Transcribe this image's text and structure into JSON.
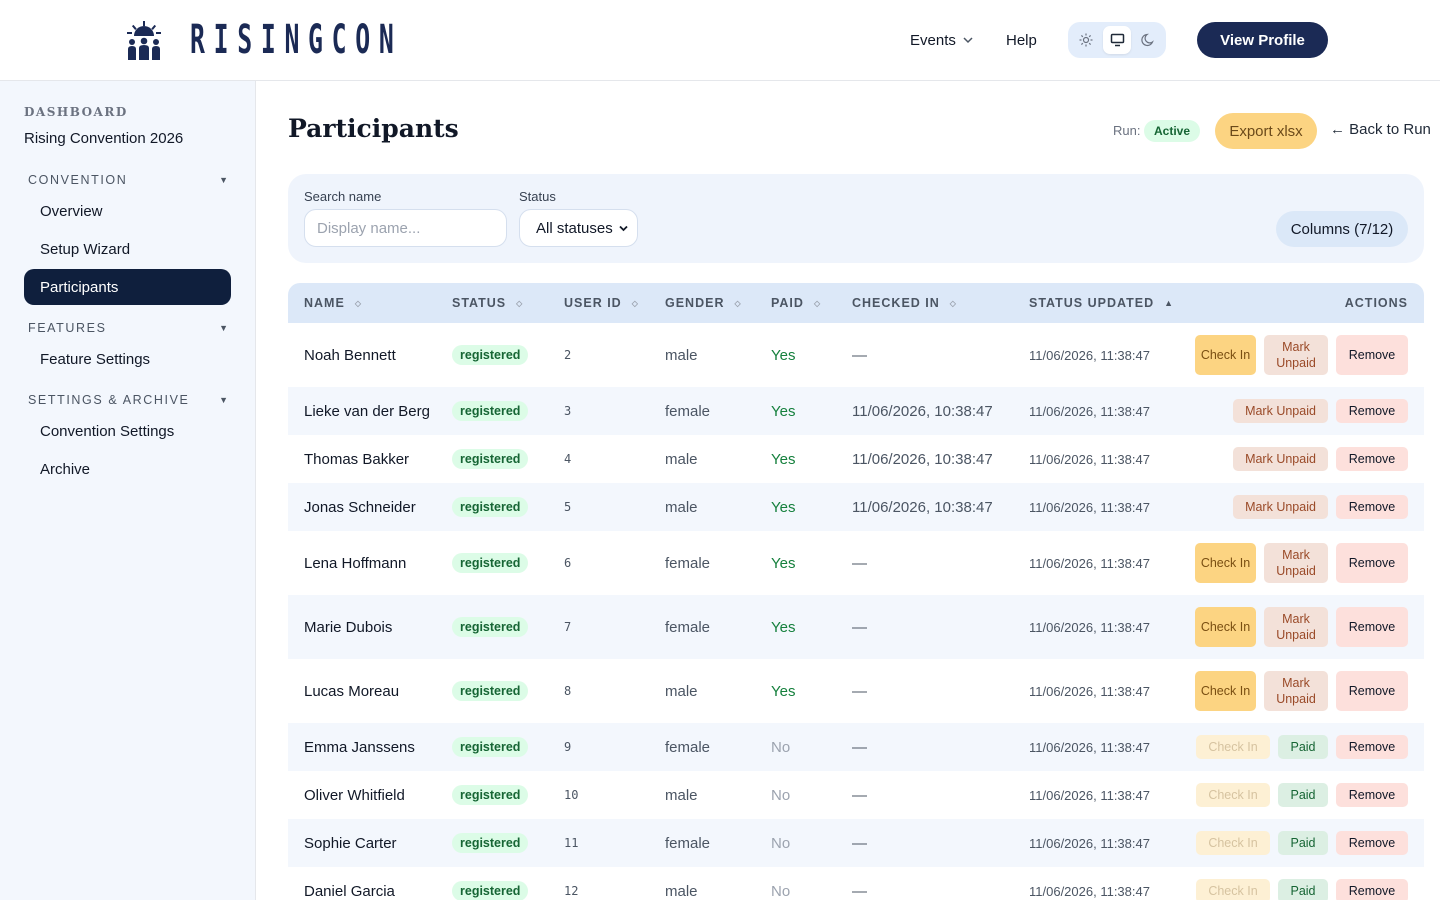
{
  "header": {
    "logo_text": "RISINGCON",
    "nav": {
      "events_label": "Events",
      "help_label": "Help"
    },
    "view_profile_label": "View Profile"
  },
  "sidebar": {
    "kicker": "DASHBOARD",
    "convention_name": "Rising Convention 2026",
    "sections": [
      {
        "title": "CONVENTION",
        "items": [
          {
            "label": "Overview"
          },
          {
            "label": "Setup Wizard"
          },
          {
            "label": "Participants",
            "active": true
          }
        ]
      },
      {
        "title": "FEATURES",
        "items": [
          {
            "label": "Feature Settings"
          }
        ]
      },
      {
        "title": "SETTINGS & ARCHIVE",
        "items": [
          {
            "label": "Convention Settings"
          },
          {
            "label": "Archive"
          }
        ]
      }
    ]
  },
  "main": {
    "title": "Participants",
    "run_label": "Run:",
    "run_status": "Active",
    "export_label": "Export xlsx",
    "back_label": "← Back to Run",
    "filters": {
      "search_label": "Search name",
      "search_placeholder": "Display name...",
      "search_value": "",
      "status_label": "Status",
      "status_selected": "All statuses",
      "columns_label": "Columns (7/12)"
    },
    "table": {
      "columns": [
        "NAME",
        "STATUS",
        "USER ID",
        "GENDER",
        "PAID",
        "CHECKED IN",
        "STATUS UPDATED",
        "ACTIONS"
      ],
      "sorted_column": "STATUS UPDATED",
      "rows": [
        {
          "name": "Noah Bennett",
          "status": "registered",
          "user_id": "2",
          "gender": "male",
          "paid": "Yes",
          "checked_in": "—",
          "updated": "11/06/2026, 11:38:47",
          "actions": [
            "Check In",
            "Mark Unpaid",
            "Remove"
          ]
        },
        {
          "name": "Lieke van der Berg",
          "status": "registered",
          "user_id": "3",
          "gender": "female",
          "paid": "Yes",
          "checked_in": "11/06/2026, 10:38:47",
          "updated": "11/06/2026, 11:38:47",
          "actions": [
            "Mark Unpaid",
            "Remove"
          ]
        },
        {
          "name": "Thomas Bakker",
          "status": "registered",
          "user_id": "4",
          "gender": "male",
          "paid": "Yes",
          "checked_in": "11/06/2026, 10:38:47",
          "updated": "11/06/2026, 11:38:47",
          "actions": [
            "Mark Unpaid",
            "Remove"
          ]
        },
        {
          "name": "Jonas Schneider",
          "status": "registered",
          "user_id": "5",
          "gender": "male",
          "paid": "Yes",
          "checked_in": "11/06/2026, 10:38:47",
          "updated": "11/06/2026, 11:38:47",
          "actions": [
            "Mark Unpaid",
            "Remove"
          ]
        },
        {
          "name": "Lena Hoffmann",
          "status": "registered",
          "user_id": "6",
          "gender": "female",
          "paid": "Yes",
          "checked_in": "—",
          "updated": "11/06/2026, 11:38:47",
          "actions": [
            "Check In",
            "Mark Unpaid",
            "Remove"
          ]
        },
        {
          "name": "Marie Dubois",
          "status": "registered",
          "user_id": "7",
          "gender": "female",
          "paid": "Yes",
          "checked_in": "—",
          "updated": "11/06/2026, 11:38:47",
          "actions": [
            "Check In",
            "Mark Unpaid",
            "Remove"
          ]
        },
        {
          "name": "Lucas Moreau",
          "status": "registered",
          "user_id": "8",
          "gender": "male",
          "paid": "Yes",
          "checked_in": "—",
          "updated": "11/06/2026, 11:38:47",
          "actions": [
            "Check In",
            "Mark Unpaid",
            "Remove"
          ]
        },
        {
          "name": "Emma Janssens",
          "status": "registered",
          "user_id": "9",
          "gender": "female",
          "paid": "No",
          "checked_in": "—",
          "updated": "11/06/2026, 11:38:47",
          "actions": [
            "Check In",
            "Paid",
            "Remove"
          ]
        },
        {
          "name": "Oliver Whitfield",
          "status": "registered",
          "user_id": "10",
          "gender": "male",
          "paid": "No",
          "checked_in": "—",
          "updated": "11/06/2026, 11:38:47",
          "actions": [
            "Check In",
            "Paid",
            "Remove"
          ]
        },
        {
          "name": "Sophie Carter",
          "status": "registered",
          "user_id": "11",
          "gender": "female",
          "paid": "No",
          "checked_in": "—",
          "updated": "11/06/2026, 11:38:47",
          "actions": [
            "Check In",
            "Paid",
            "Remove"
          ]
        },
        {
          "name": "Daniel Garcia",
          "status": "registered",
          "user_id": "12",
          "gender": "male",
          "paid": "No",
          "checked_in": "—",
          "updated": "11/06/2026, 11:38:47",
          "actions": [
            "Check In",
            "Paid",
            "Remove"
          ]
        }
      ]
    }
  },
  "colors": {
    "brand_navy": "#1b2a55",
    "sidebar_active": "#0f1f3d",
    "accent_amber": "#fcd482",
    "status_green": "#dcfce7",
    "remove_pink": "#fde0dc"
  },
  "icons": {
    "logo": "rising-sun-people-icon",
    "events": "chevron-down-icon",
    "theme": [
      "sun-icon",
      "monitor-icon",
      "moon-icon"
    ],
    "sort": "sort-arrows-icon"
  }
}
